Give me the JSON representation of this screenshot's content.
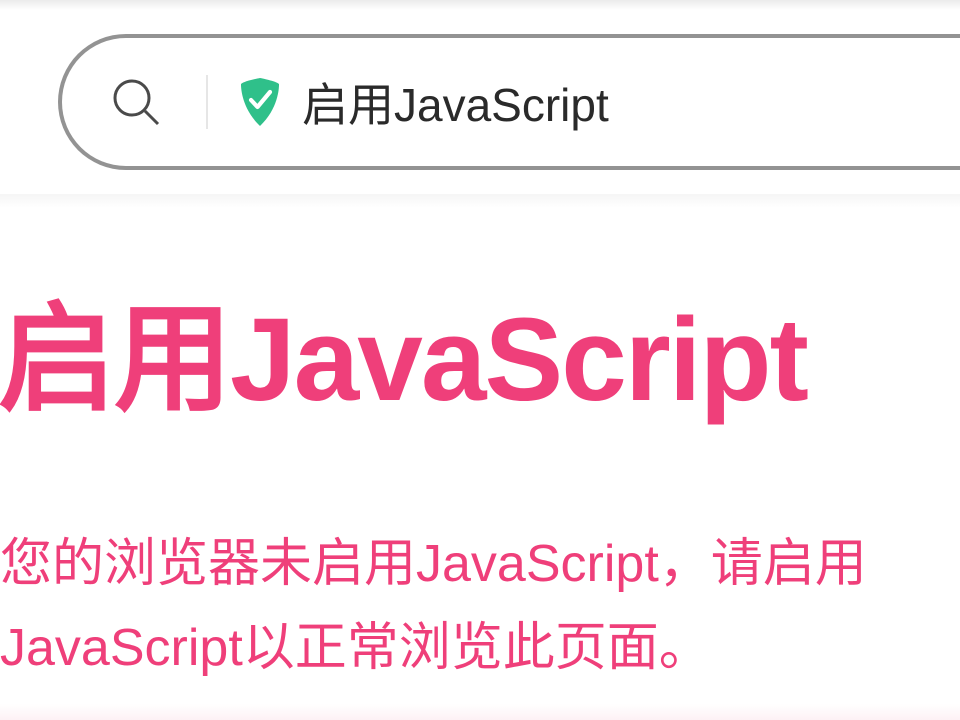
{
  "addressbar": {
    "url_display": "启用JavaScript",
    "secure_icon": "secure-shield",
    "secure_color": "#2fc08a"
  },
  "page": {
    "headline": "启用JavaScript",
    "body": "您的浏览器未启用JavaScript，请启用JavaScript以正常浏览此页面。",
    "accent_color": "#ef3f7a"
  }
}
